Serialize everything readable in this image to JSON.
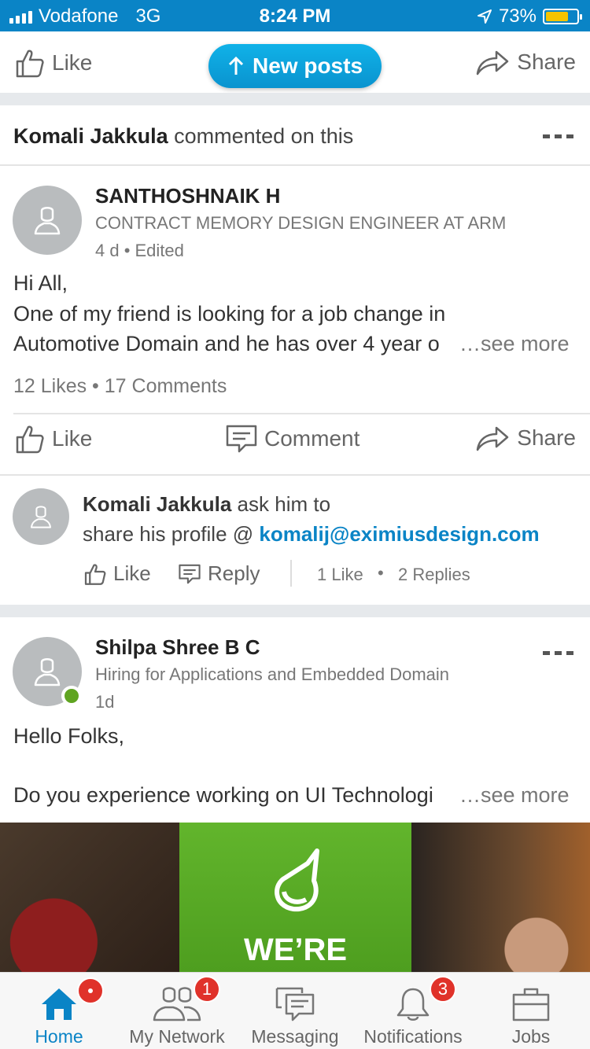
{
  "status_bar": {
    "carrier": "Vodafone",
    "network": "3G",
    "time": "8:24 PM",
    "battery": "73%",
    "battery_level": 0.73
  },
  "top_actions": {
    "like": "Like",
    "new_posts": "New posts",
    "share": "Share"
  },
  "post1": {
    "context_name": "Komali Jakkula",
    "context_text": "commented on this",
    "author": "SANTHOSHNAIK H",
    "headline": "CONTRACT MEMORY DESIGN ENGINEER AT ARM",
    "meta": "4 d • Edited",
    "body_line1": "Hi All,",
    "body_line2": "One of my friend is looking for a job change in",
    "body_line3": "Automotive Domain and he has over 4 year o",
    "see_more": "…see more",
    "stats": "12 Likes • 17 Comments",
    "actions": {
      "like": "Like",
      "comment": "Comment",
      "share": "Share"
    }
  },
  "comment": {
    "author": "Komali Jakkula",
    "text1": "ask him to",
    "text2": "share his profile @",
    "email": "komalij@eximiusdesign.com",
    "like": "Like",
    "reply": "Reply",
    "likes": "1 Like",
    "replies": "2 Replies"
  },
  "post2": {
    "author": "Shilpa Shree B C",
    "headline": "Hiring for Applications and Embedded Domain",
    "time": "1d",
    "body_line1": "Hello Folks,",
    "body_line2": "Do you experience working on UI Technologi",
    "see_more": "…see more",
    "banner_text": "WE’RE"
  },
  "bottom_nav": {
    "items": [
      {
        "label": "Home",
        "badge": ""
      },
      {
        "label": "My Network",
        "badge": "1"
      },
      {
        "label": "Messaging",
        "badge": ""
      },
      {
        "label": "Notifications",
        "badge": "3"
      },
      {
        "label": "Jobs",
        "badge": ""
      }
    ]
  },
  "colors": {
    "accent": "#0a84c6",
    "badge": "#e0322a",
    "online": "#5fa421"
  }
}
